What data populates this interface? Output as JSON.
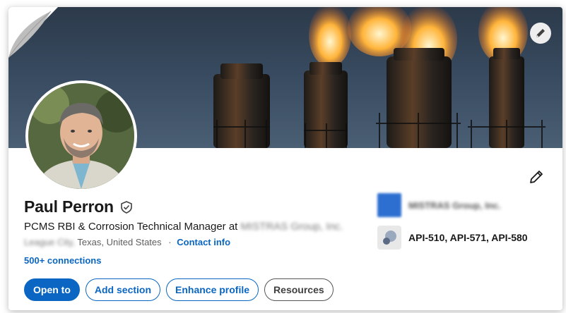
{
  "profile": {
    "name": "Paul Perron",
    "headline_prefix": "PCMS RBI & Corrosion Technical Manager at",
    "headline_company": "MISTRAS Group, Inc.",
    "location_city": "League City,",
    "location_region": "Texas, United States",
    "location_separator": "·",
    "contact_info_label": "Contact info",
    "connections_label": "500+ connections"
  },
  "actions": {
    "open_to": "Open to",
    "add_section": "Add section",
    "enhance_profile": "Enhance profile",
    "resources": "Resources"
  },
  "sidebar": {
    "company_name": "MISTRAS Group, Inc.",
    "certifications": "API-510, API-571, API-580"
  },
  "icons": {
    "banner_edit": "pencil-icon",
    "profile_edit": "pencil-icon",
    "verified": "shield-check-icon"
  },
  "colors": {
    "accent": "#0a66c2",
    "company_logo": "#2d6fd0"
  }
}
